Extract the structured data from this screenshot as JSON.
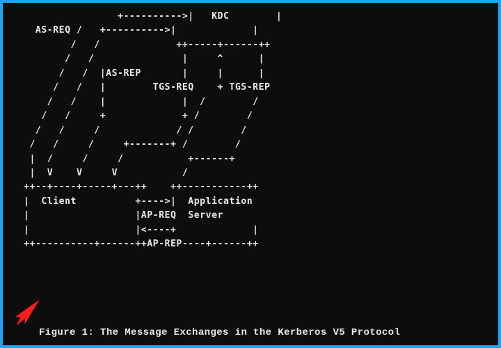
{
  "caption": "Figure 1:  The Message Exchanges in the Kerberos V5 Protocol",
  "nodes": {
    "kdc": "KDC",
    "client": "Client",
    "app_server_1": "Application",
    "app_server_2": "Server"
  },
  "messages": {
    "as_req": "AS-REQ",
    "as_rep": "AS-REP",
    "tgs_req": "TGS-REQ",
    "tgs_rep": "TGS-REP",
    "ap_req": "AP-REQ",
    "ap_rep": "AP-REP"
  },
  "diagram_lines": [
    "                +---------->|   %KDC%       |",
    "  %AS_REQ% /   +---------->|             |",
    "        /   /             ++-----+------++",
    "       /   /               |     ^      |",
    "      /   /  |%AS_REP%       |     |      |",
    "     /   /   |        %TGS_REQ%    + %TGS_REP%",
    "    /   /    |             |  /        /",
    "   /   /     +             + /        /",
    "  /   /     /             / /        /",
    " /   /     /     +-------+ /        /",
    " |  /     /     /           +------+",
    " |  V    V     V           /",
    "++--+----+-----+---++    ++-----------++",
    "|  %CLIENT%          +---->|  %APPSRV1%",
    "|                  |%AP_REQ%  %APPSRV2%",
    "|                  |<----+             |",
    "++----------+------++%AP_REP%----+------++"
  ],
  "annotation_icon": "red-arrow-pointer"
}
